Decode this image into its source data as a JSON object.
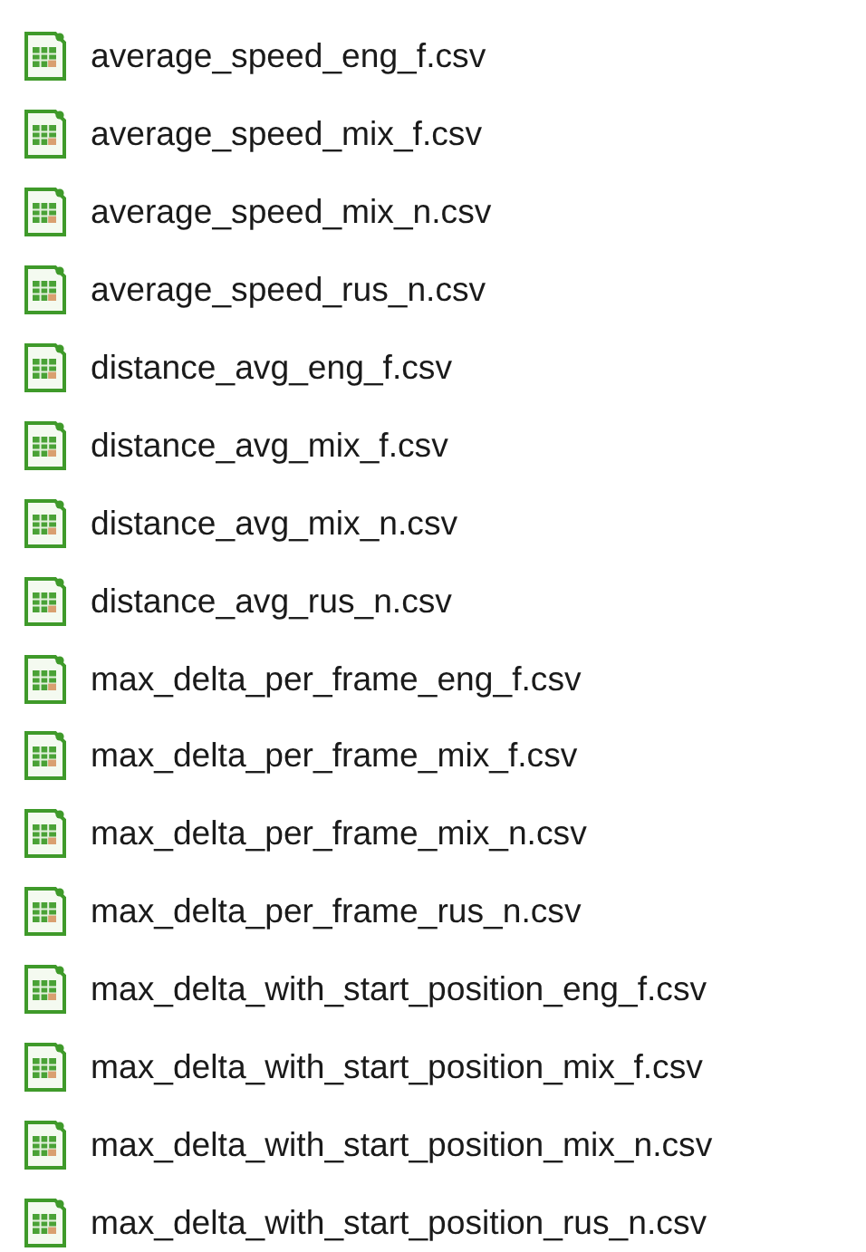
{
  "files": [
    {
      "name": "average_speed_eng_f.csv"
    },
    {
      "name": "average_speed_mix_f.csv"
    },
    {
      "name": "average_speed_mix_n.csv"
    },
    {
      "name": "average_speed_rus_n.csv"
    },
    {
      "name": "distance_avg_eng_f.csv"
    },
    {
      "name": "distance_avg_mix_f.csv"
    },
    {
      "name": "distance_avg_mix_n.csv"
    },
    {
      "name": "distance_avg_rus_n.csv"
    },
    {
      "name": "max_delta_per_frame_eng_f.csv"
    },
    {
      "name": "max_delta_per_frame_mix_f.csv"
    },
    {
      "name": "max_delta_per_frame_mix_n.csv"
    },
    {
      "name": "max_delta_per_frame_rus_n.csv"
    },
    {
      "name": "max_delta_with_start_position_eng_f.csv"
    },
    {
      "name": "max_delta_with_start_position_mix_f.csv"
    },
    {
      "name": "max_delta_with_start_position_mix_n.csv"
    },
    {
      "name": "max_delta_with_start_position_rus_n.csv"
    }
  ]
}
